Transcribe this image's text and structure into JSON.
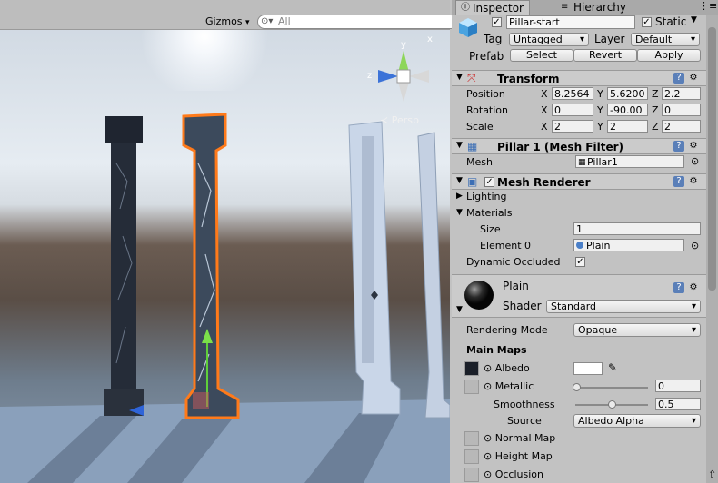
{
  "scene": {
    "gizmos_label": "Gizmos",
    "search_placeholder": "All",
    "persp_label": "Persp",
    "axis_y": "y",
    "axis_x": "x",
    "axis_z": "z"
  },
  "tabs": [
    {
      "label": "Inspector"
    },
    {
      "label": "Hierarchy"
    }
  ],
  "object": {
    "name": "Pillar-start",
    "static_label": "Static",
    "tag_label": "Tag",
    "tag_value": "Untagged",
    "layer_label": "Layer",
    "layer_value": "Default",
    "prefab_label": "Prefab",
    "select_label": "Select",
    "revert_label": "Revert",
    "apply_label": "Apply"
  },
  "transform": {
    "title": "Transform",
    "position_label": "Position",
    "rotation_label": "Rotation",
    "scale_label": "Scale",
    "x": "X",
    "y": "Y",
    "z": "Z",
    "position": {
      "x": "8.2564",
      "y": "5.6200",
      "z": "2.2"
    },
    "rotation": {
      "x": "0",
      "y": "-90.00",
      "z": "0"
    },
    "scale": {
      "x": "2",
      "y": "2",
      "z": "2"
    }
  },
  "mesh_filter": {
    "title": "Pillar 1 (Mesh Filter)",
    "mesh_label": "Mesh",
    "mesh_value": "Pillar1"
  },
  "mesh_renderer": {
    "title": "Mesh Renderer",
    "lighting_label": "Lighting",
    "materials_label": "Materials",
    "size_label": "Size",
    "size_value": "1",
    "element0_label": "Element 0",
    "element0_value": "Plain",
    "dynamic_occluded_label": "Dynamic Occluded"
  },
  "material": {
    "name": "Plain",
    "shader_label": "Shader",
    "shader_value": "Standard",
    "rendering_mode_label": "Rendering Mode",
    "rendering_mode_value": "Opaque",
    "main_maps_label": "Main Maps",
    "albedo_label": "Albedo",
    "metallic_label": "Metallic",
    "metallic_value": "0",
    "smoothness_label": "Smoothness",
    "smoothness_value": "0.5",
    "smoothness_level": 0.5,
    "source_label": "Source",
    "source_value": "Albedo Alpha",
    "normal_map_label": "Normal Map",
    "height_map_label": "Height Map",
    "occlusion_label": "Occlusion"
  },
  "colors": {
    "selection_outline": "#ff7a1a",
    "inspector_bg": "#c2c2c2",
    "header_bg": "#cbcbcb"
  }
}
